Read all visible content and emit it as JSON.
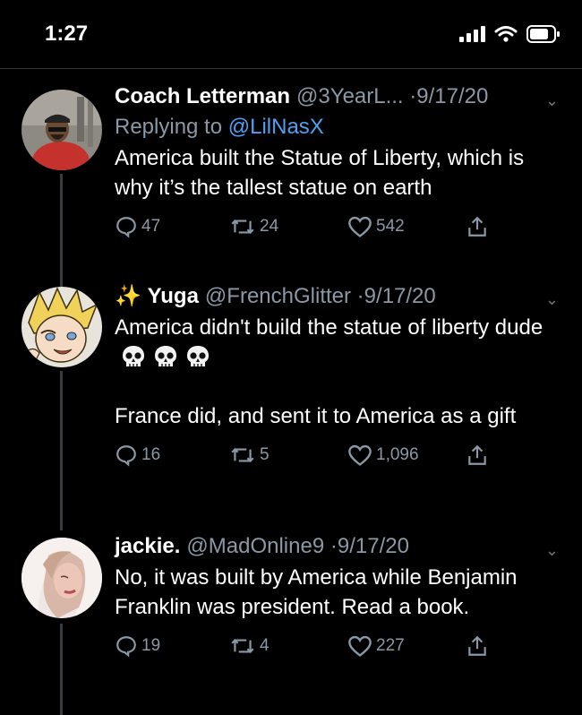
{
  "status_bar": {
    "time": "1:27"
  },
  "tweets": [
    {
      "name": "Coach Letterman",
      "handle": "@3YearL...",
      "date": "9/17/20",
      "replying_to_prefix": "Replying to",
      "replying_to": "@LilNasX",
      "text": [
        "America built the Statue of Liberty, which is why it’s the tallest statue on earth"
      ],
      "replies": "47",
      "retweets": "24",
      "likes": "542"
    },
    {
      "prefix_emoji": "✨",
      "name": "Yuga",
      "handle": "@FrenchGlitter",
      "date": "9/17/20",
      "text": [
        "America didn't build the statue of liberty dude",
        "France did, and sent it to America as a gift"
      ],
      "replies": "16",
      "retweets": "5",
      "likes": "1,096"
    },
    {
      "name": "jackie.",
      "handle": "@MadOnline9",
      "date": "9/17/20",
      "text": [
        "No, it was built by America while Benjamin Franklin was president. Read a book."
      ],
      "replies": "19",
      "retweets": "4",
      "likes": "227"
    }
  ],
  "icons": {
    "reply": "speech-bubble-icon",
    "retweet": "retweet-arrows-icon",
    "like": "heart-icon",
    "share": "share-arrow-icon",
    "more": "chevron-down-icon",
    "skull": "skull-emoji"
  },
  "colors": {
    "background": "#000000",
    "mention": "#4da1f2",
    "muted": "#8b98a5"
  }
}
